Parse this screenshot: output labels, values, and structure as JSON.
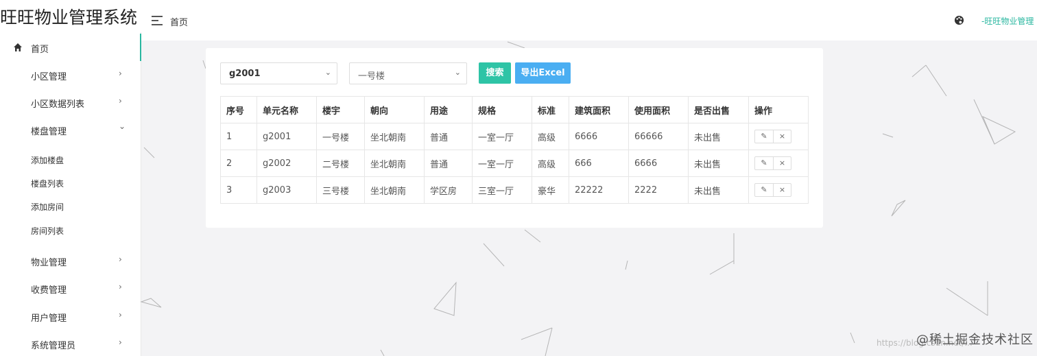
{
  "header": {
    "app_title": "旺旺物业管理系统",
    "breadcrumb": "首页",
    "user_name": "-旺旺物业管理",
    "accent": "#2ab7a0"
  },
  "sidebar": {
    "home": "首页",
    "items": [
      {
        "label": "小区管理",
        "arrow": "›"
      },
      {
        "label": "小区数据列表",
        "arrow": "›"
      },
      {
        "label": "楼盘管理",
        "arrow": "⌄"
      },
      {
        "label": "物业管理",
        "arrow": "›"
      },
      {
        "label": "收费管理",
        "arrow": "›"
      },
      {
        "label": "用户管理",
        "arrow": "›"
      },
      {
        "label": "系统管理员",
        "arrow": "›"
      }
    ],
    "sub_items": [
      "添加楼盘",
      "楼盘列表",
      "添加房间",
      "房间列表"
    ]
  },
  "filters": {
    "unit_select": "g2001",
    "building_select": "一号楼",
    "search_button": "搜索",
    "export_button": "导出Excel",
    "search_color": "#2ec4a6",
    "export_color": "#4aaef2"
  },
  "table": {
    "headers": [
      "序号",
      "单元名称",
      "楼宇",
      "朝向",
      "用途",
      "规格",
      "标准",
      "建筑面积",
      "使用面积",
      "是否出售",
      "操作"
    ],
    "rows": [
      [
        "1",
        "g2001",
        "一号楼",
        "坐北朝南",
        "普通",
        "一室一厅",
        "高级",
        "6666",
        "66666",
        "未出售"
      ],
      [
        "2",
        "g2002",
        "二号楼",
        "坐北朝南",
        "普通",
        "一室一厅",
        "高级",
        "666",
        "6666",
        "未出售"
      ],
      [
        "3",
        "g2003",
        "三号楼",
        "坐北朝南",
        "学区房",
        "三室一厅",
        "豪华",
        "22222",
        "2222",
        "未出售"
      ]
    ],
    "edit_icon": "✎",
    "delete_icon": "×"
  },
  "watermark": {
    "url": "https://blog.csdn.net/...",
    "text": "@稀土掘金技术社区"
  }
}
